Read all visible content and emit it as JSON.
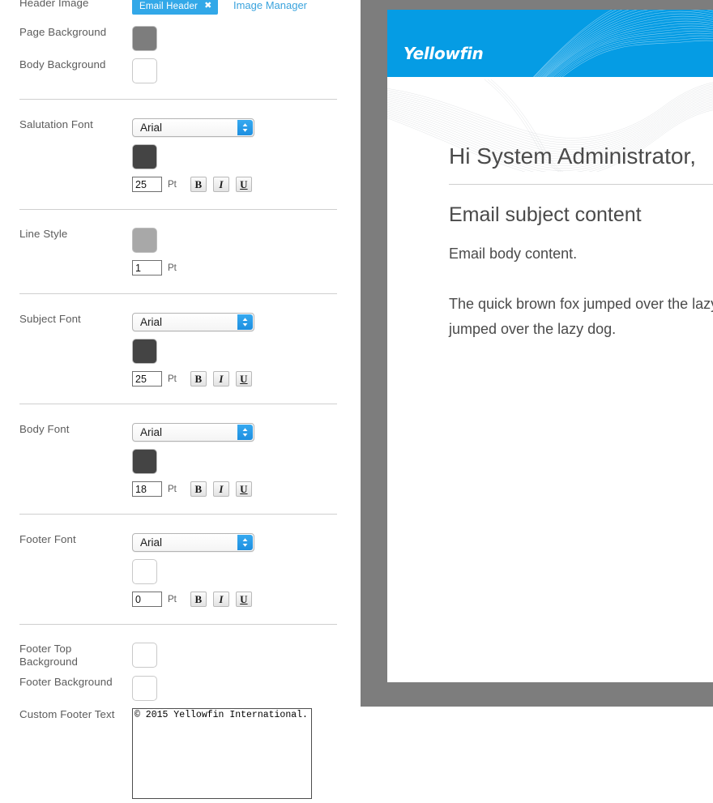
{
  "settings": {
    "header_image": {
      "label": "Header Image",
      "chip_label": "Email Header",
      "chip_close": "✖",
      "image_manager_link": "Image Manager"
    },
    "page_background": {
      "label": "Page Background",
      "color": "#7d7d7d"
    },
    "body_background": {
      "label": "Body Background",
      "color": "#ffffff"
    },
    "salutation_font": {
      "label": "Salutation Font",
      "font": "Arial",
      "color": "#444444",
      "size": "25",
      "unit": "Pt",
      "bold": "B",
      "italic": "I",
      "underline": "U"
    },
    "line_style": {
      "label": "Line Style",
      "color": "#a8a8a8",
      "size": "1",
      "unit": "Pt"
    },
    "subject_font": {
      "label": "Subject Font",
      "font": "Arial",
      "color": "#444444",
      "size": "25",
      "unit": "Pt",
      "bold": "B",
      "italic": "I",
      "underline": "U"
    },
    "body_font": {
      "label": "Body Font",
      "font": "Arial",
      "color": "#444444",
      "size": "18",
      "unit": "Pt",
      "bold": "B",
      "italic": "I",
      "underline": "U"
    },
    "footer_font": {
      "label": "Footer Font",
      "font": "Arial",
      "color": "#ffffff",
      "size": "0",
      "unit": "Pt",
      "bold": "B",
      "italic": "I",
      "underline": "U"
    },
    "footer_top_background": {
      "label": "Footer Top Background",
      "color": "#ffffff"
    },
    "footer_background": {
      "label": "Footer Background",
      "color": "#ffffff"
    },
    "custom_footer_text": {
      "label": "Custom Footer Text",
      "value": "© 2015 Yellowfin International."
    }
  },
  "preview": {
    "panel_background": "#7d7d7d",
    "banner_color": "#059ce4",
    "logo_text": "Yellowfin",
    "salutation": "Hi System Administrator,",
    "subject": "Email subject content",
    "body_line_1": "Email body content.",
    "body_line_2": "The quick brown fox jumped over the lazy dog. The quick brown fox jumped over the lazy dog."
  }
}
